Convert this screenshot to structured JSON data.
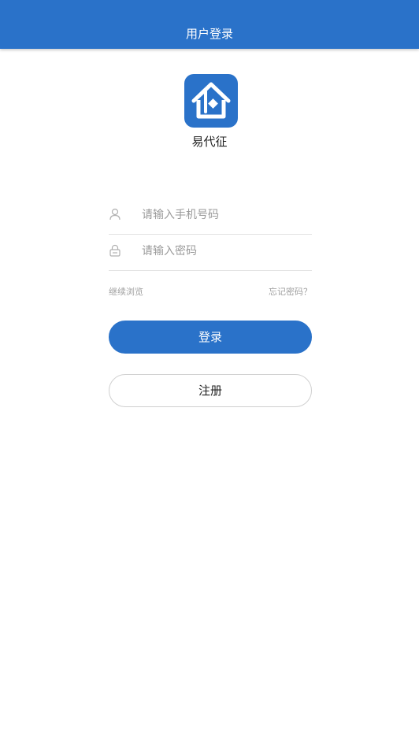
{
  "header": {
    "title": "用户登录"
  },
  "app": {
    "name": "易代征",
    "logo_icon": "house-logo-icon"
  },
  "form": {
    "phone": {
      "icon": "user-icon",
      "placeholder": "请输入手机号码",
      "value": ""
    },
    "password": {
      "icon": "lock-icon",
      "placeholder": "请输入密码",
      "value": ""
    }
  },
  "links": {
    "continue_browse": "继续浏览",
    "forgot_password": "忘记密码？"
  },
  "buttons": {
    "login": "登录",
    "register": "注册"
  },
  "colors": {
    "primary": "#2a72c9",
    "placeholder": "#9a9a9a",
    "link": "#a0a0a0",
    "divider": "#e3e3e3"
  }
}
